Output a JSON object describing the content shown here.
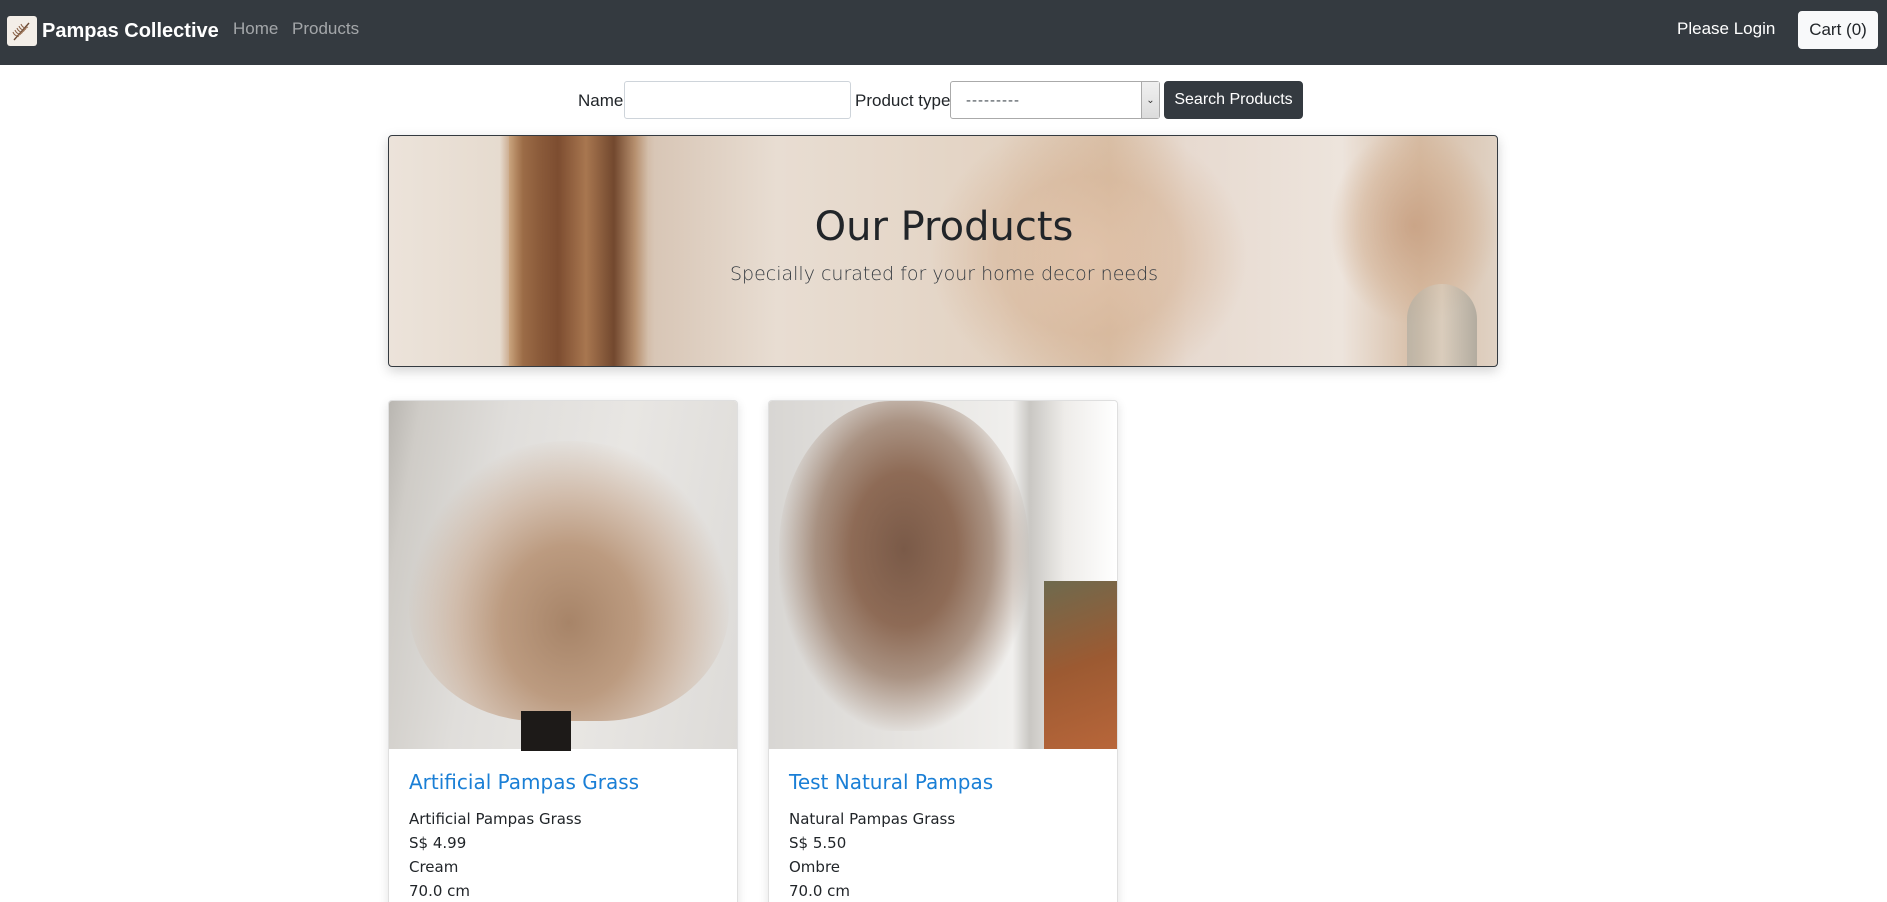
{
  "navbar": {
    "brand": "Pampas Collective",
    "links": [
      "Home",
      "Products"
    ],
    "login": "Please Login",
    "cart": "Cart (0)"
  },
  "search": {
    "name_label": "Name",
    "name_value": "",
    "type_label": "Product type",
    "type_selected": "---------",
    "button": "Search Products"
  },
  "hero": {
    "title": "Our Products",
    "subtitle": "Specially curated for your home decor needs"
  },
  "products": [
    {
      "title": "Artificial Pampas Grass",
      "type": "Artificial Pampas Grass",
      "price": "S$ 4.99",
      "color": "Cream",
      "length": "70.0 cm"
    },
    {
      "title": "Test Natural Pampas",
      "type": "Natural Pampas Grass",
      "price": "S$ 5.50",
      "color": "Ombre",
      "length": "70.0 cm"
    }
  ],
  "colors": {
    "navbar_bg": "#343a40",
    "link": "#1a7fd6",
    "button_dark": "#343a40"
  }
}
